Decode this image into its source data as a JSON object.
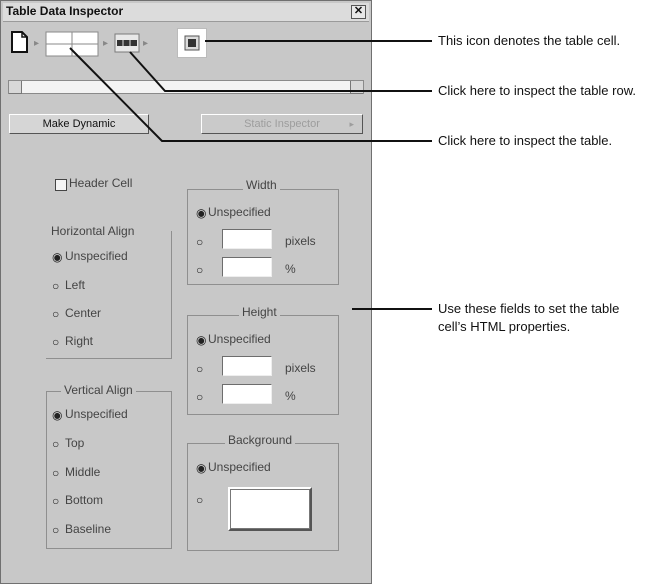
{
  "window": {
    "title": "Table Data Inspector",
    "close_glyph": "✕"
  },
  "tag_icons": [
    "document-icon",
    "table-icon",
    "table-row-icon",
    "table-cell-icon"
  ],
  "make_dynamic_label": "Make Dynamic",
  "static_inspector_label": "Static Inspector",
  "header_cell_label": "Header Cell",
  "horizontal_align": {
    "title": "Horizontal Align",
    "options": [
      "Unspecified",
      "Left",
      "Center",
      "Right"
    ],
    "selected": "Unspecified"
  },
  "vertical_align": {
    "title": "Vertical Align",
    "options": [
      "Unspecified",
      "Top",
      "Middle",
      "Bottom",
      "Baseline"
    ],
    "selected": "Unspecified"
  },
  "width": {
    "title": "Width",
    "unspecified": "Unspecified",
    "pixels": "pixels",
    "percent": "%"
  },
  "height": {
    "title": "Height",
    "unspecified": "Unspecified",
    "pixels": "pixels",
    "percent": "%"
  },
  "background": {
    "title": "Background",
    "unspecified": "Unspecified"
  },
  "callouts": {
    "cell": "This icon denotes the table cell.",
    "row": "Click here to inspect the table row.",
    "table": "Click here to inspect the table.",
    "fields_line1": "Use these fields to set the table",
    "fields_line2": "cell’s HTML properties."
  }
}
